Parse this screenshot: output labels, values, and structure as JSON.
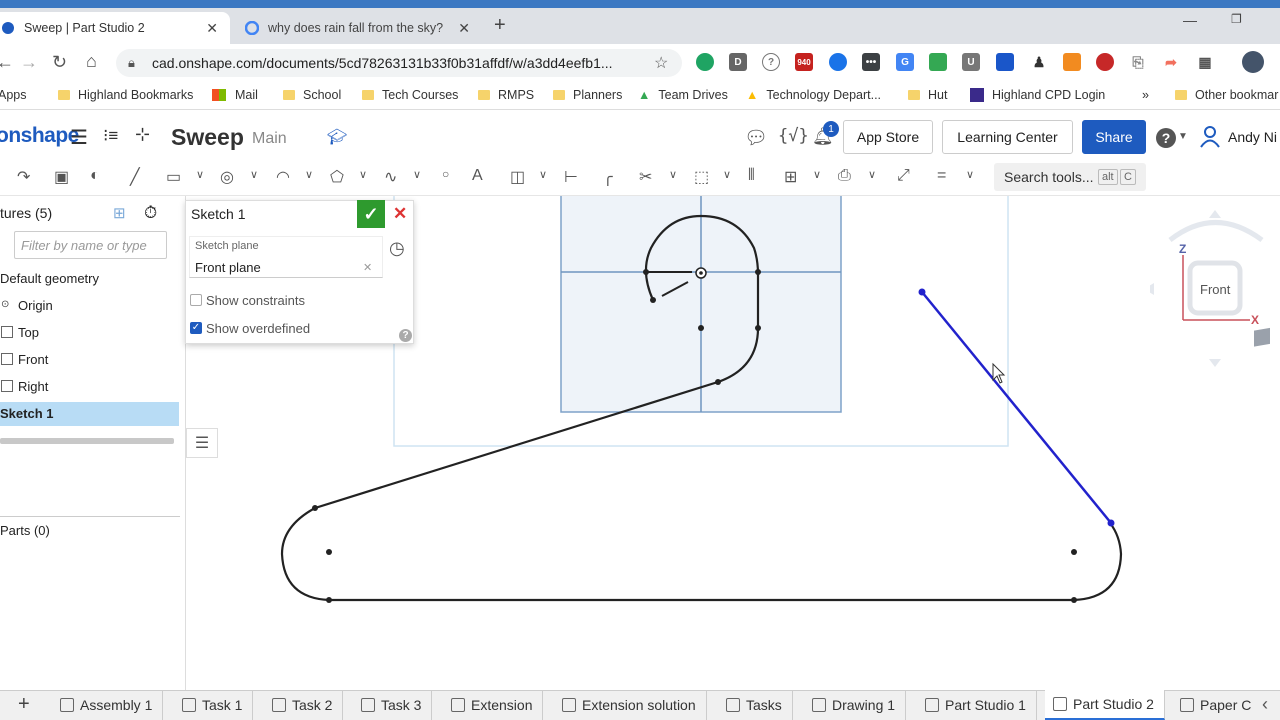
{
  "browser": {
    "tabs": [
      {
        "title": "Sweep | Part Studio 2",
        "active": true
      },
      {
        "title": "why does rain fall from the sky? -",
        "active": false
      }
    ],
    "url": "cad.onshape.com/documents/5cd78263131b33f0b31affdf/w/a3dd4eefb1...",
    "gmail_badge": "940",
    "bookmarks": [
      "Apps",
      "Highland Bookmarks",
      "Mail",
      "School",
      "Tech Courses",
      "RMPS",
      "Planners",
      "Team Drives",
      "Technology Depart...",
      "Hut",
      "Highland CPD  Login",
      "»",
      "Other bookmar"
    ]
  },
  "header": {
    "logo": "onshape",
    "doc_title": "Sweep",
    "branch": "Main",
    "notification_count": "1",
    "app_store": "App Store",
    "learning_center": "Learning Center",
    "share": "Share",
    "user": "Andy Ni"
  },
  "toolbar": {
    "search_label": "Search tools...",
    "shortcut_alt": "alt",
    "shortcut_key": "C"
  },
  "features": {
    "header": "tures (5)",
    "filter_placeholder": "Filter by name or type",
    "items": [
      "Default geometry",
      "Origin",
      "Top",
      "Front",
      "Right",
      "Sketch 1"
    ],
    "parts": "Parts (0)"
  },
  "sketch_dialog": {
    "title": "Sketch 1",
    "plane_label": "Sketch plane",
    "plane_value": "Front plane",
    "show_constraints": "Show constraints",
    "show_constraints_checked": false,
    "show_overdefined": "Show overdefined",
    "show_overdefined_checked": true
  },
  "viewcube": {
    "face": "Front",
    "axis_z": "Z",
    "axis_x": "X"
  },
  "bottom_tabs": [
    {
      "label": "Assembly 1"
    },
    {
      "label": "Task 1"
    },
    {
      "label": "Task 2"
    },
    {
      "label": "Task 3"
    },
    {
      "label": "Extension"
    },
    {
      "label": "Extension solution"
    },
    {
      "label": "Tasks"
    },
    {
      "label": "Drawing 1"
    },
    {
      "label": "Part Studio 1"
    },
    {
      "label": "Part Studio 2",
      "active": true
    },
    {
      "label": "Paper C"
    }
  ],
  "colors": {
    "accent": "#2a6fd6",
    "share_button": "#1e5bbf",
    "check_green": "#2e9a2e",
    "close_red": "#d33",
    "selection_blue": "#2222cc",
    "selected_row": "#b8dcf5"
  }
}
